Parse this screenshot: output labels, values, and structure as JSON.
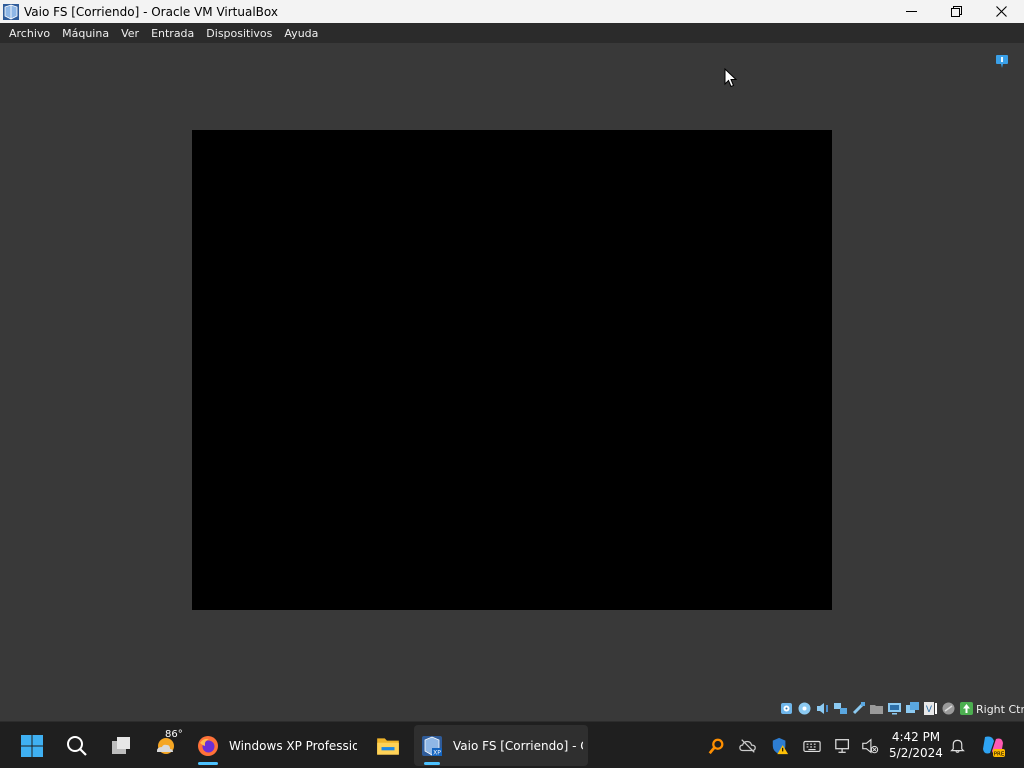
{
  "window": {
    "title": "Vaio FS [Corriendo] - Oracle VM VirtualBox"
  },
  "menu": {
    "items": [
      "Archivo",
      "Máquina",
      "Ver",
      "Entrada",
      "Dispositivos",
      "Ayuda"
    ]
  },
  "statusbar": {
    "icons": [
      "hard-disk-icon",
      "optical-drive-icon",
      "audio-icon",
      "network-icon",
      "usb-icon",
      "shared-folders-icon",
      "display-icon",
      "recording-icon",
      "virtualization-icon",
      "mouse-integration-icon",
      "host-key-icon"
    ],
    "host_key": "Right Ctrl"
  },
  "taskbar": {
    "weather_temp": "86°",
    "apps": [
      {
        "name": "firefox",
        "label": "Windows XP Professional"
      },
      {
        "name": "file-explorer",
        "label": ""
      },
      {
        "name": "virtualbox",
        "label": "Vaio FS [Corriendo] - Oracle VM VirtualBox"
      }
    ],
    "clock_time": "4:42 PM",
    "clock_date": "5/2/2024"
  },
  "colors": {
    "accent": "#4cc2ff",
    "vm_background": "#393939",
    "taskbar": "#1f1f1f",
    "titlebar": "#f3f3f3"
  }
}
